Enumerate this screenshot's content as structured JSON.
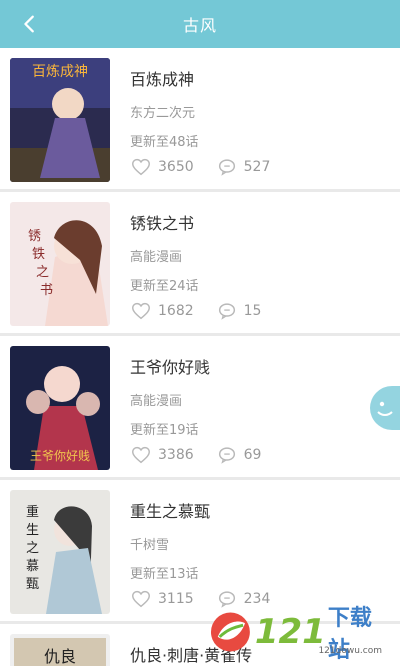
{
  "header": {
    "title": "古风",
    "back_icon": "chevron-left-icon"
  },
  "list": {
    "items": [
      {
        "title": "百炼成神",
        "author": "东方二次元",
        "update": "更新至48话",
        "likes": "3650",
        "comments": "527",
        "cover_colors": [
          "#2b2b4f",
          "#6b5b9d",
          "#f2d8c5"
        ]
      },
      {
        "title": "锈铁之书",
        "author": "高能漫画",
        "update": "更新至24话",
        "likes": "1682",
        "comments": "15",
        "cover_colors": [
          "#f4e8e8",
          "#c53b3b",
          "#6b3d2e"
        ]
      },
      {
        "title": "王爷你好贱",
        "author": "高能漫画",
        "update": "更新至19话",
        "likes": "3386",
        "comments": "69",
        "cover_colors": [
          "#1c2244",
          "#b3354c",
          "#f5d8cf"
        ]
      },
      {
        "title": "重生之慕甄",
        "author": "千树雪",
        "update": "更新至13话",
        "likes": "3115",
        "comments": "234",
        "cover_colors": [
          "#e8e7e3",
          "#4e5a6e",
          "#b0c8d6"
        ]
      },
      {
        "title": "仇良·刺唐·黄雀传",
        "author": "",
        "update": "",
        "likes": "",
        "comments": "",
        "cover_colors": [
          "#efefef",
          "#222222",
          "#d3c7b1"
        ]
      }
    ]
  },
  "watermark": {
    "number": "121",
    "text": "下载站",
    "url": "121dowu.com"
  }
}
